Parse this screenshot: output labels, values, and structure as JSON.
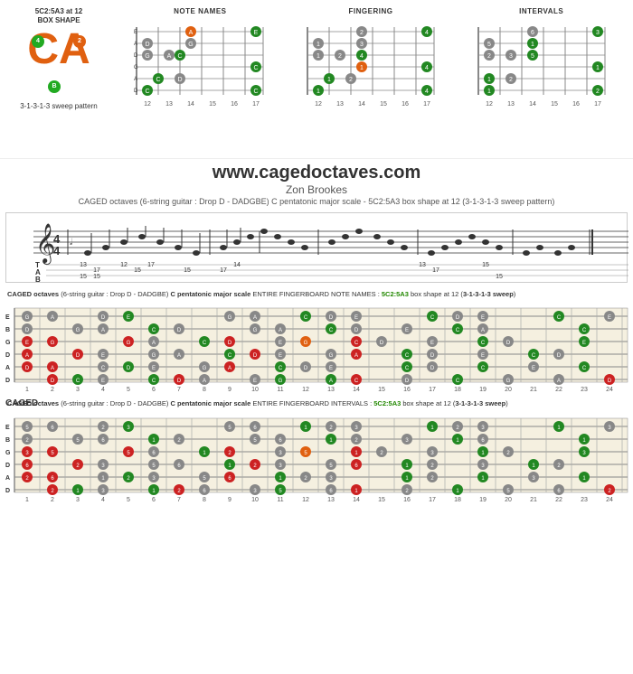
{
  "page": {
    "title": "CAGED Octaves - 5C2:5A3 box shape at 12",
    "website_url": "www.cagedoctaves.com",
    "author": "Zon Brookes",
    "description": "CAGED octaves (6-string guitar : Drop D - DADGBE) C pentatonic major scale - 5C2:5A3 box shape at 12 (3-1-3-1-3 sweep pattern)",
    "logo_title": "5C2:5A3 at 12\nBOX SHAPE",
    "ca_letters": "CA",
    "ca_dot1": "4",
    "ca_dot2": "2",
    "ca_dot3": "B",
    "sweep_label": "3-1-3-1-3 sweep pattern"
  },
  "diagrams": [
    {
      "header": "NOTE NAMES",
      "fret_start": 12,
      "fret_end": 17
    },
    {
      "header": "FINGERING",
      "fret_start": 12,
      "fret_end": 17
    },
    {
      "header": "INTERVALS",
      "fret_start": 12,
      "fret_end": 17
    }
  ],
  "fret_numbers_top": [
    12,
    13,
    14,
    15,
    16,
    17
  ],
  "caged_label": "CAGED",
  "fingerboard1": {
    "title_parts": [
      {
        "text": "CAGED octaves (6-string guitar : Drop D - DADGBE) ",
        "bold": false
      },
      {
        "text": "C pentatonic major scale",
        "bold": true
      },
      {
        "text": " ENTIRE FINGERBOARD NOTE NAMES : ",
        "bold": false
      },
      {
        "text": "5C2:5A3",
        "bold": true,
        "color": "green"
      },
      {
        "text": " box shape at 12 (",
        "bold": false
      },
      {
        "text": "3-1-3-1-3 sweep",
        "bold": true
      },
      {
        "text": ")",
        "bold": false
      }
    ],
    "fret_numbers": [
      1,
      2,
      3,
      4,
      5,
      6,
      7,
      8,
      9,
      10,
      11,
      12,
      13,
      14,
      15,
      16,
      17,
      18,
      19,
      20,
      21,
      22,
      23,
      24
    ]
  },
  "fingerboard2": {
    "title_parts": [
      {
        "text": "CAGED octaves (6-string guitar : Drop D - DADGBE) ",
        "bold": false
      },
      {
        "text": "C pentatonic major scale",
        "bold": true
      },
      {
        "text": " ENTIRE FINGERBOARD INTERVALS : ",
        "bold": false
      },
      {
        "text": "5C2:5A3",
        "bold": true,
        "color": "green"
      },
      {
        "text": " box shape at 12 (",
        "bold": false
      },
      {
        "text": "3-1-3-1-3 sweep",
        "bold": true
      },
      {
        "text": ")",
        "bold": false
      }
    ],
    "fret_numbers": [
      1,
      2,
      3,
      4,
      5,
      6,
      7,
      8,
      9,
      10,
      11,
      12,
      13,
      14,
      15,
      16,
      17,
      18,
      19,
      20,
      21,
      22,
      23,
      24
    ]
  }
}
